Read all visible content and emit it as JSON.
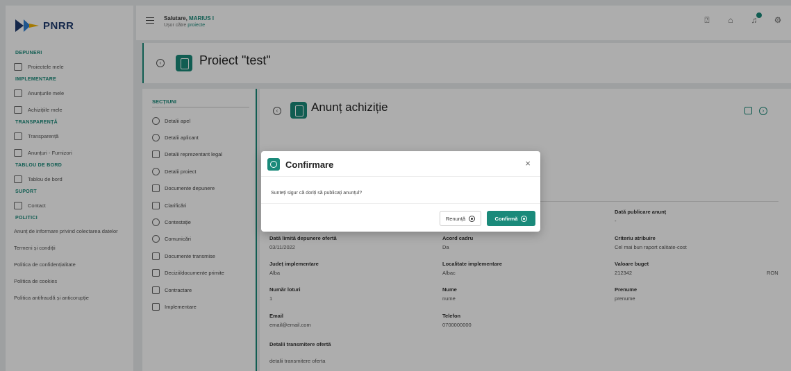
{
  "logo": {
    "text": "PNRR"
  },
  "sidebar": {
    "sections": [
      {
        "title": "DEPUNERI",
        "items": [
          "Proiectele mele"
        ]
      },
      {
        "title": "IMPLEMENTARE",
        "items": [
          "Anunțurile mele",
          "Achizițiile mele"
        ]
      },
      {
        "title": "TRANSPARENȚĂ",
        "items": [
          "Transparență",
          "Anunțuri - Furnizori"
        ]
      },
      {
        "title": "TABLOU DE BORD",
        "items": [
          "Tablou de bord"
        ]
      },
      {
        "title": "SUPORT",
        "items": [
          "Contact"
        ]
      },
      {
        "title": "POLITICI",
        "links": [
          "Anunț de informare privind colectarea datelor",
          "Termeni și condiții",
          "Politica de confidențialitate",
          "Politica de cookies",
          "Politica antifraudă și anticorupție"
        ]
      }
    ]
  },
  "topbar": {
    "greeting": "Salutare,",
    "user_name": "MARIUS I",
    "subtitle_prefix": "Ușor către",
    "subtitle_highlight": "proiecte"
  },
  "project": {
    "title": "Proiect \"test\""
  },
  "sections_panel": {
    "title": "SECȚIUNI",
    "items": [
      "Detalii apel",
      "Detalii aplicant",
      "Detalii reprezentant legal",
      "Detalii proiect",
      "Documente depunere",
      "Clarificări",
      "Contestație",
      "Comunicări",
      "Documente transmise",
      "Decizii/documente primite",
      "Contractare",
      "Implementare"
    ]
  },
  "main": {
    "title": "Anunț achiziție",
    "fields": [
      {
        "label": "Dată publicare anunț",
        "value": "-"
      },
      {
        "label": "Dată limită depunere ofertă",
        "value": "03/11/2022"
      },
      {
        "label": "Acord cadru",
        "value": "Da"
      },
      {
        "label": "Criteriu atribuire",
        "value": "Cel mai bun raport calitate-cost"
      },
      {
        "label": "Județ implementare",
        "value": "Alba"
      },
      {
        "label": "Localitate implementare",
        "value": "Albac"
      },
      {
        "label": "Valoare buget",
        "value": "212342"
      },
      {
        "label": "Număr loturi",
        "value": "1"
      },
      {
        "label": "Nume",
        "value": "nume"
      },
      {
        "label": "Prenume",
        "value": "prenume"
      },
      {
        "label": "Email",
        "value": "email@email.com"
      },
      {
        "label": "Telefon",
        "value": "0700000000"
      },
      {
        "label": "Detalii transmitere ofertă",
        "value": "detalii transmitere oferta"
      }
    ],
    "currency": "RON"
  },
  "modal": {
    "title": "Confirmare",
    "close": "×",
    "message": "Sunteți sigur că doriți să publicați anunțul?",
    "cancel_label": "Renunță",
    "confirm_label": "Confirmă"
  },
  "colors": {
    "accent": "#1a8a7a",
    "navy": "#1e3a6e",
    "overlay": "rgba(0,0,0,0.32)"
  }
}
